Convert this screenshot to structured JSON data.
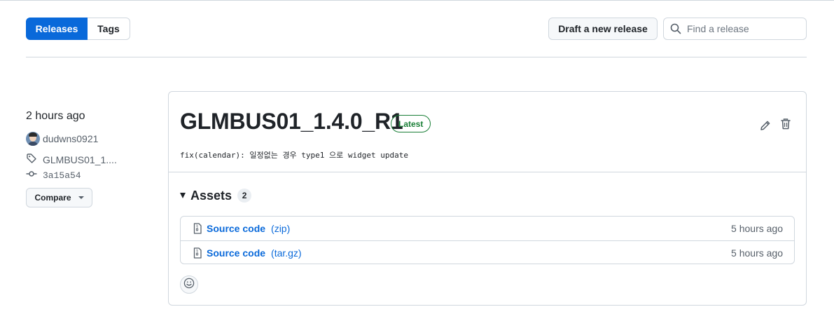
{
  "tabs": {
    "releases_label": "Releases",
    "tags_label": "Tags"
  },
  "toolbar": {
    "draft_label": "Draft a new release",
    "search_placeholder": "Find a release"
  },
  "meta": {
    "time": "2 hours ago",
    "author": "dudwns0921",
    "tag": "GLMBUS01_1....",
    "commit": "3a15a54",
    "compare_label": "Compare"
  },
  "release": {
    "title": "GLMBUS01_1.4.0_R1",
    "badge": "Latest",
    "commit_message": "fix(calendar): 일정없는 경우 type1 으로 widget update"
  },
  "assets": {
    "label": "Assets",
    "count": "2",
    "items": [
      {
        "name": "Source code",
        "format": "(zip)",
        "ago": "5 hours ago"
      },
      {
        "name": "Source code",
        "format": "(tar.gz)",
        "ago": "5 hours ago"
      }
    ]
  },
  "colors": {
    "accent": "#0969da",
    "latest": "#1a7f37",
    "border": "#d0d7de"
  },
  "icons": [
    "search-icon",
    "tag-icon",
    "commit-icon",
    "pencil-icon",
    "trash-icon",
    "file-zip-icon",
    "smiley-icon",
    "chevron-down-icon"
  ]
}
